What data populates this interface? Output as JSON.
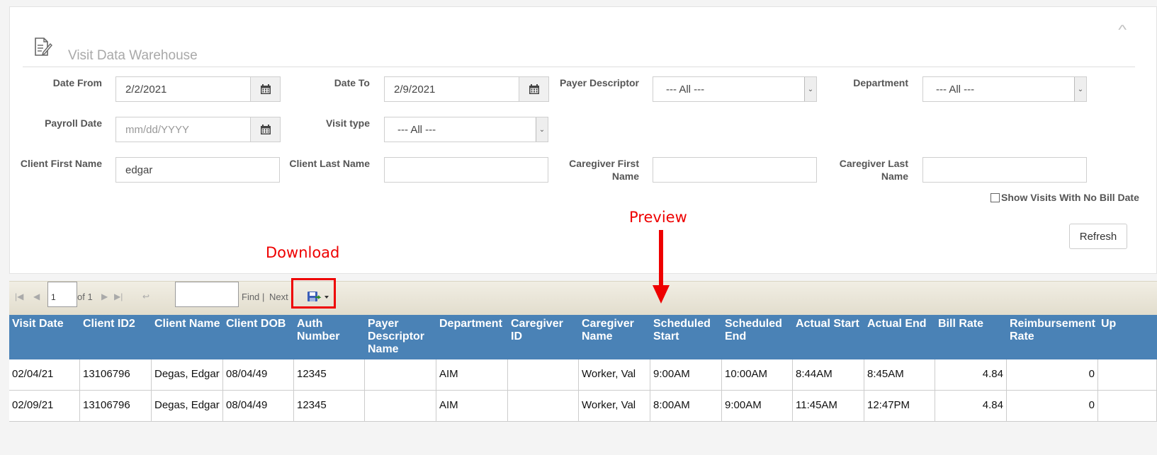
{
  "panel": {
    "title": "Visit Data Warehouse",
    "collapse_icon": "chevron-up-icon"
  },
  "filters": {
    "date_from": {
      "label": "Date From",
      "value": "2/2/2021"
    },
    "date_to": {
      "label": "Date To",
      "value": "2/9/2021"
    },
    "payer_descriptor": {
      "label": "Payer Descriptor",
      "value": "--- All ---"
    },
    "department": {
      "label": "Department",
      "value": "--- All ---"
    },
    "payroll_date": {
      "label": "Payroll Date",
      "placeholder": "mm/dd/YYYY"
    },
    "visit_type": {
      "label": "Visit type",
      "value": "--- All ---"
    },
    "client_first_name": {
      "label": "Client First Name",
      "value": "edgar"
    },
    "client_last_name": {
      "label": "Client Last Name",
      "value": ""
    },
    "caregiver_first_name": {
      "label_line1": "Caregiver First",
      "label_line2": "Name",
      "value": ""
    },
    "caregiver_last_name": {
      "label_line1": "Caregiver Last",
      "label_line2": "Name",
      "value": ""
    },
    "show_no_bill": {
      "label": "Show Visits With No Bill Date",
      "checked": false
    },
    "refresh_label": "Refresh"
  },
  "toolbar": {
    "page": "1",
    "of_label": "of 1",
    "find_label": "Find",
    "separator": "|",
    "next_label": "Next"
  },
  "annotations": {
    "download": "Download",
    "preview": "Preview"
  },
  "grid": {
    "header_color": "#4a82b6",
    "columns": [
      [
        "Visit Date"
      ],
      [
        "Client ID2"
      ],
      [
        "Client Name"
      ],
      [
        "Client DOB"
      ],
      [
        "Auth",
        "Number"
      ],
      [
        "Payer",
        "Descriptor",
        "Name"
      ],
      [
        "Department"
      ],
      [
        "Caregiver",
        "ID"
      ],
      [
        "Caregiver",
        "Name"
      ],
      [
        "Scheduled",
        "Start"
      ],
      [
        "Scheduled",
        "End"
      ],
      [
        "Actual Start"
      ],
      [
        "Actual End"
      ],
      [
        "Bill Rate"
      ],
      [
        "Reimbursement",
        "Rate"
      ],
      [
        "Up"
      ]
    ],
    "rows": [
      [
        "02/04/21",
        "13106796",
        "Degas, Edgar",
        "08/04/49",
        "12345",
        "",
        "AIM",
        "",
        "Worker, Val",
        "9:00AM",
        "10:00AM",
        "8:44AM",
        "8:45AM",
        "4.84",
        "0",
        ""
      ],
      [
        "02/09/21",
        "13106796",
        "Degas, Edgar",
        "08/04/49",
        "12345",
        "",
        "AIM",
        "",
        "Worker, Val",
        "8:00AM",
        "9:00AM",
        "11:45AM",
        "12:47PM",
        "4.84",
        "0",
        ""
      ]
    ]
  }
}
